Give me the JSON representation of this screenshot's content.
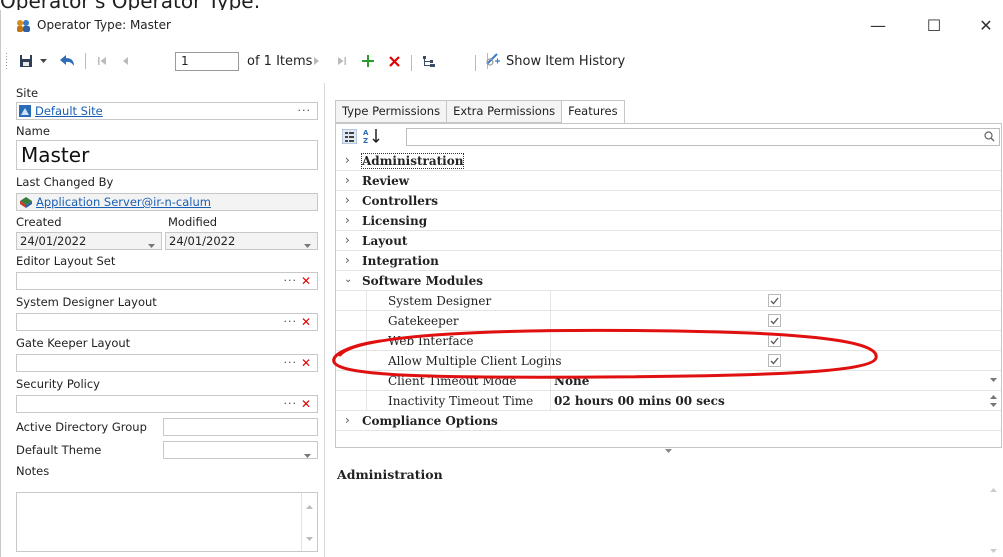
{
  "page_caption": "Operator's Operator Type:",
  "window": {
    "title": "Operator Type: Master",
    "minimize_label": "—",
    "maximize_label": "☐",
    "close_label": "✕"
  },
  "toolbar": {
    "record_number": "1",
    "record_count_label": "of 1 Items",
    "show_history_label": "Show Item History"
  },
  "form": {
    "site_label": "Site",
    "site_value": "Default Site",
    "name_label": "Name",
    "name_value": "Master",
    "last_changed_label": "Last Changed By",
    "last_changed_value": "Application Server@ir-n-calum",
    "created_label": "Created",
    "created_value": "24/01/2022",
    "modified_label": "Modified",
    "modified_value": "24/01/2022",
    "editor_layout_label": "Editor Layout Set",
    "system_designer_layout_label": "System Designer Layout",
    "gate_keeper_layout_label": "Gate Keeper Layout",
    "security_policy_label": "Security Policy",
    "ad_group_label": "Active Directory Group",
    "default_theme_label": "Default Theme",
    "notes_label": "Notes"
  },
  "tabs": [
    {
      "label": "Type Permissions",
      "active": false
    },
    {
      "label": "Extra Permissions",
      "active": false
    },
    {
      "label": "Features",
      "active": true
    }
  ],
  "grid": {
    "rows": [
      {
        "type": "category",
        "label": "Administration",
        "expanded": false
      },
      {
        "type": "category",
        "label": "Review",
        "expanded": false
      },
      {
        "type": "category",
        "label": "Controllers",
        "expanded": false
      },
      {
        "type": "category",
        "label": "Licensing",
        "expanded": false
      },
      {
        "type": "category",
        "label": "Layout",
        "expanded": false
      },
      {
        "type": "category",
        "label": "Integration",
        "expanded": false
      },
      {
        "type": "category",
        "label": "Software Modules",
        "expanded": true
      },
      {
        "type": "checkbox",
        "label": "System Designer",
        "checked": true
      },
      {
        "type": "checkbox",
        "label": "Gatekeeper",
        "checked": true
      },
      {
        "type": "checkbox",
        "label": "Web Interface",
        "checked": true
      },
      {
        "type": "checkbox",
        "label": "Allow Multiple Client Logins",
        "checked": true
      },
      {
        "type": "dropdown",
        "label": "Client Timeout Mode",
        "value": "None"
      },
      {
        "type": "spinner",
        "label": "Inactivity Timeout Time",
        "value": "02 hours 00 mins 00 secs"
      },
      {
        "type": "category",
        "label": "Compliance Options",
        "expanded": false
      }
    ]
  },
  "description": {
    "heading": "Administration"
  },
  "colors": {
    "annotation": "#e01010",
    "link": "#1a5fb4",
    "delete_x": "#e00000",
    "add_plus": "#2e9b2e"
  }
}
